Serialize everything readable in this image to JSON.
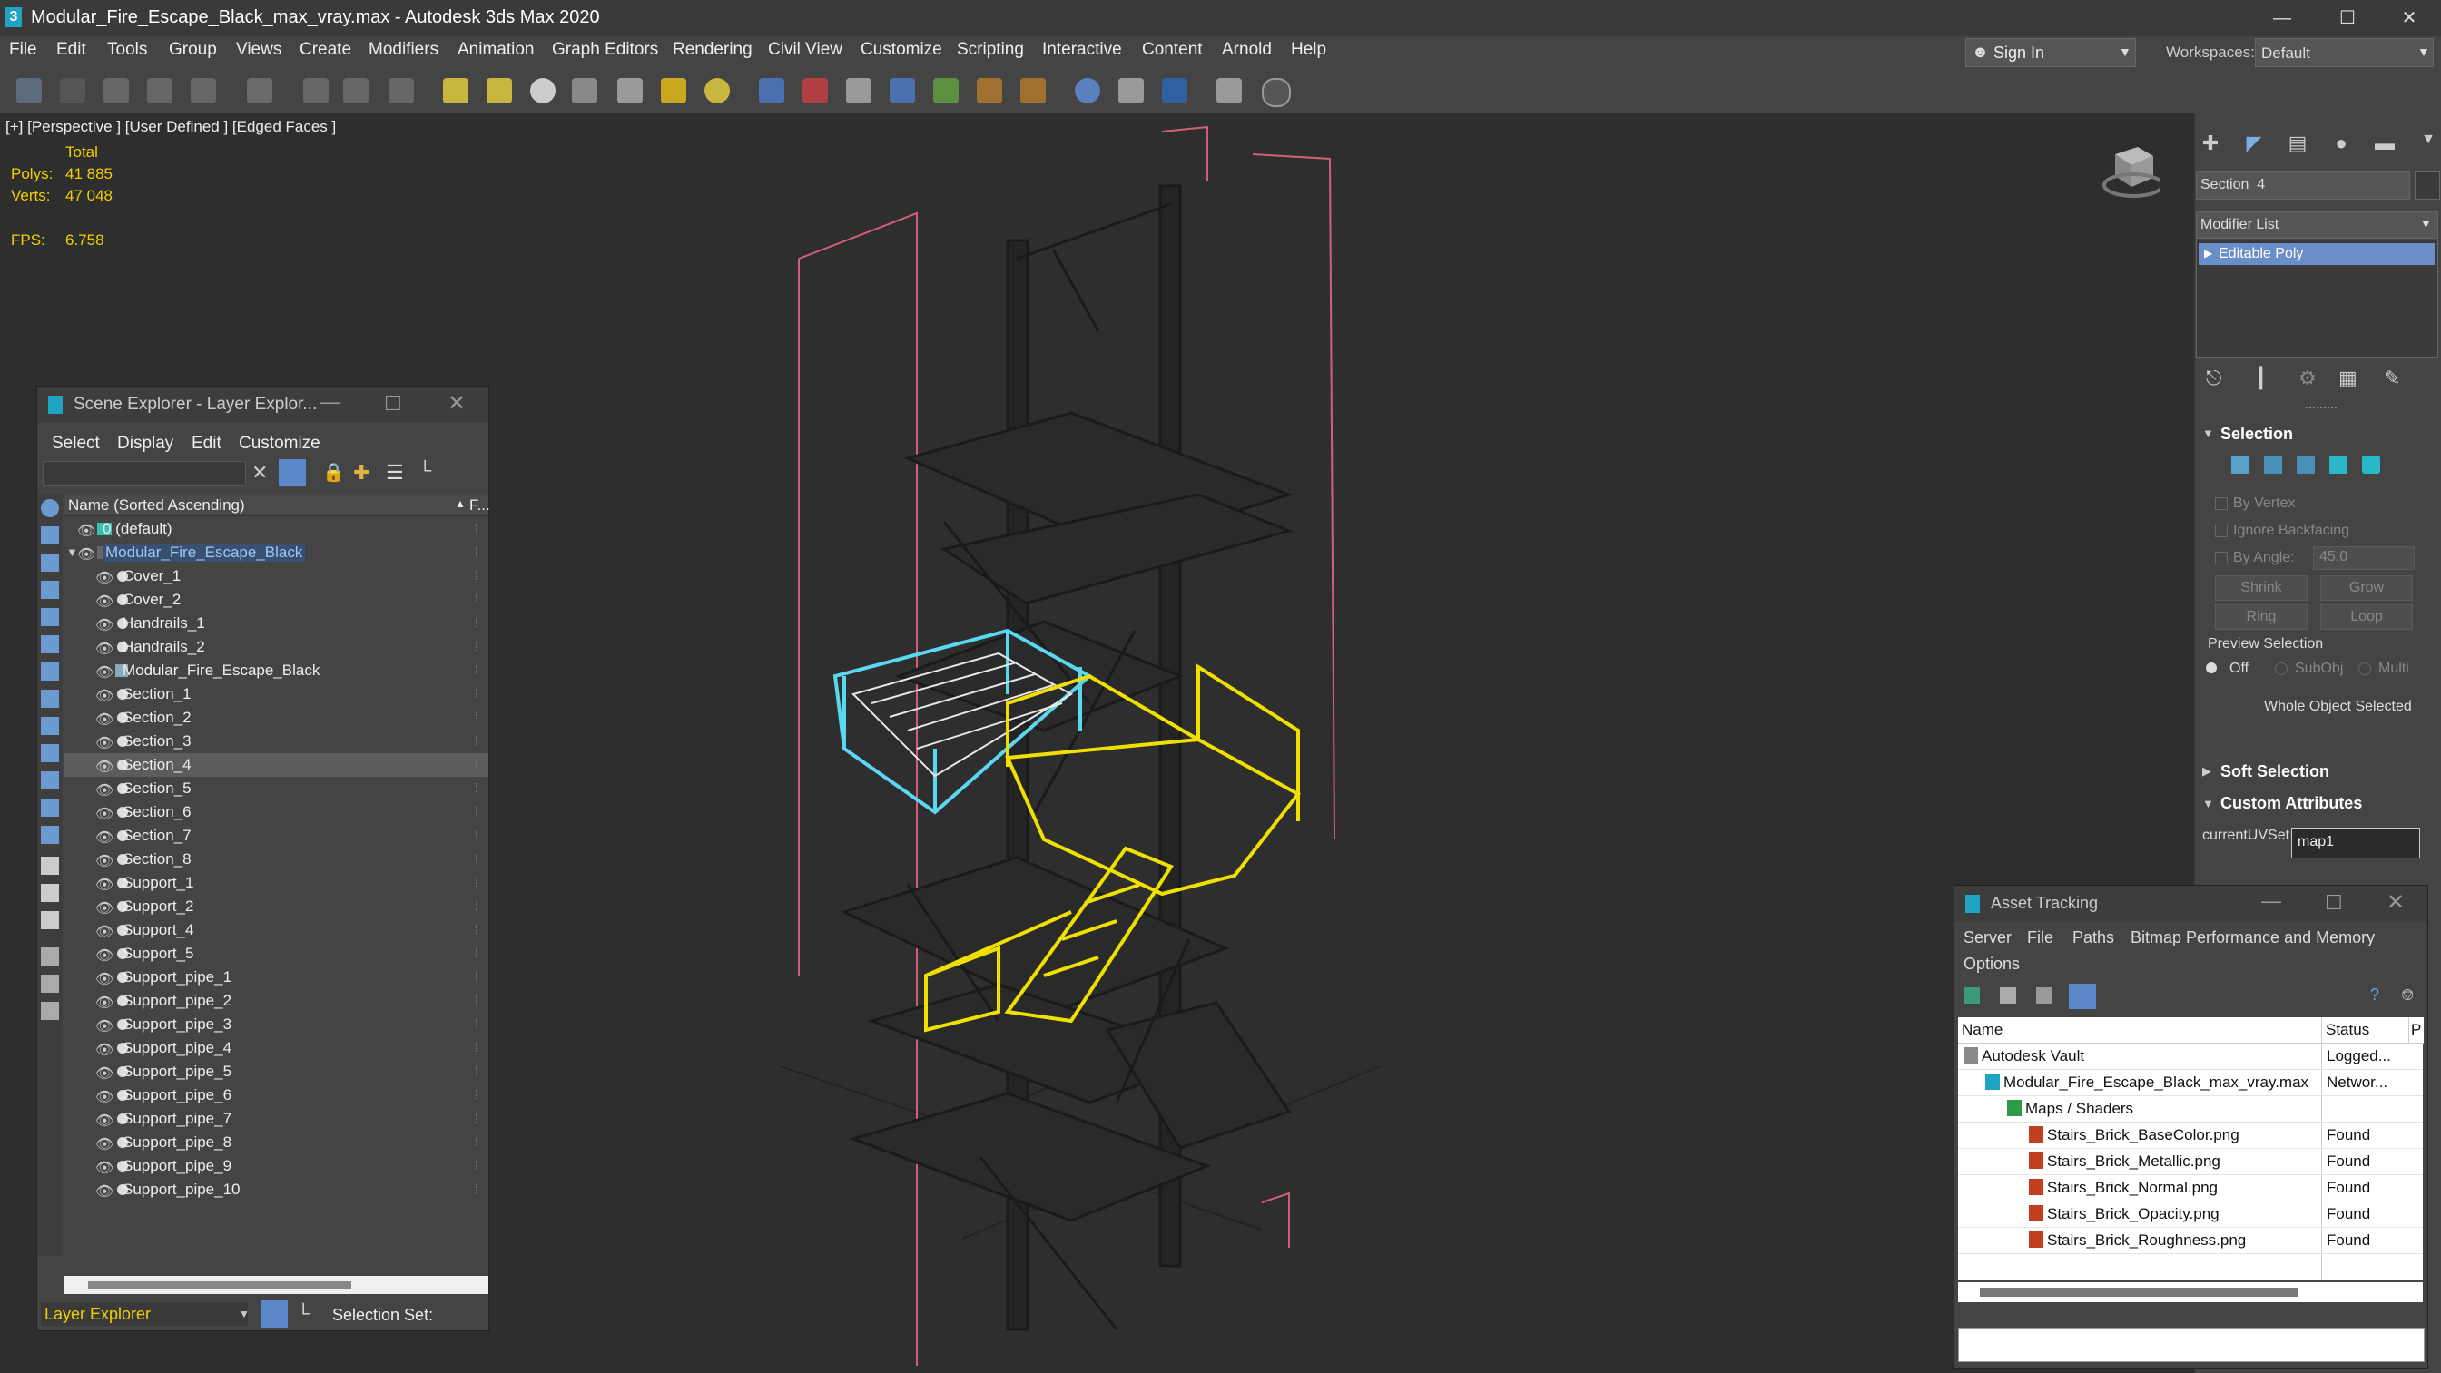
{
  "app": {
    "title": "Modular_Fire_Escape_Black_max_vray.max - Autodesk 3ds Max 2020",
    "window_controls": [
      "—",
      "☐",
      "✕"
    ]
  },
  "menubar": {
    "items": [
      "File",
      "Edit",
      "Tools",
      "Group",
      "Views",
      "Create",
      "Modifiers",
      "Animation",
      "Graph Editors",
      "Rendering",
      "Civil View",
      "Customize",
      "Scripting",
      "Interactive",
      "Content",
      "Arnold",
      "Help"
    ],
    "sign_in": "Sign In",
    "workspaces_label": "Workspaces:",
    "workspace": "Default"
  },
  "viewport": {
    "label": "[+] [Perspective ] [User Defined ] [Edged Faces ]",
    "stats": {
      "total_label": "Total",
      "polys_label": "Polys:",
      "polys": "41 885",
      "verts_label": "Verts:",
      "verts": "47 048",
      "fps_label": "FPS:",
      "fps": "6.758"
    }
  },
  "command_panel": {
    "object_name": "Section_4",
    "modifier_list": "Modifier List",
    "stack_item": "Editable Poly",
    "selection": {
      "header": "Selection",
      "by_vertex": "By Vertex",
      "ignore_backfacing": "Ignore Backfacing",
      "by_angle": "By Angle:",
      "angle_value": "45.0",
      "shrink": "Shrink",
      "grow": "Grow",
      "ring": "Ring",
      "loop": "Loop",
      "preview_selection": "Preview Selection",
      "off": "Off",
      "subobj": "SubObj",
      "multi": "Multi",
      "status": "Whole Object Selected"
    },
    "soft_selection": "Soft Selection",
    "custom_attributes": "Custom Attributes",
    "current_uv_label": "currentUVSet",
    "current_uv_value": "map1"
  },
  "scene_explorer": {
    "title": "Scene Explorer - Layer Explor...",
    "menu": [
      "Select",
      "Display",
      "Edit",
      "Customize"
    ],
    "column_header": "Name (Sorted Ascending)",
    "column_extra": "F...",
    "rows": [
      {
        "label": "0 (default)",
        "level": 0,
        "kind": "layer"
      },
      {
        "label": "Modular_Fire_Escape_Black",
        "level": 0,
        "kind": "layer-open"
      },
      {
        "label": "Cover_1",
        "level": 1,
        "kind": "obj"
      },
      {
        "label": "Cover_2",
        "level": 1,
        "kind": "obj"
      },
      {
        "label": "Handrails_1",
        "level": 1,
        "kind": "obj"
      },
      {
        "label": "Handrails_2",
        "level": 1,
        "kind": "obj"
      },
      {
        "label": "Modular_Fire_Escape_Black",
        "level": 1,
        "kind": "group"
      },
      {
        "label": "Section_1",
        "level": 1,
        "kind": "obj"
      },
      {
        "label": "Section_2",
        "level": 1,
        "kind": "obj"
      },
      {
        "label": "Section_3",
        "level": 1,
        "kind": "obj"
      },
      {
        "label": "Section_4",
        "level": 1,
        "kind": "obj-selected"
      },
      {
        "label": "Section_5",
        "level": 1,
        "kind": "obj"
      },
      {
        "label": "Section_6",
        "level": 1,
        "kind": "obj"
      },
      {
        "label": "Section_7",
        "level": 1,
        "kind": "obj"
      },
      {
        "label": "Section_8",
        "level": 1,
        "kind": "obj"
      },
      {
        "label": "Support_1",
        "level": 1,
        "kind": "obj"
      },
      {
        "label": "Support_2",
        "level": 1,
        "kind": "obj"
      },
      {
        "label": "Support_4",
        "level": 1,
        "kind": "obj"
      },
      {
        "label": "Support_5",
        "level": 1,
        "kind": "obj"
      },
      {
        "label": "Support_pipe_1",
        "level": 1,
        "kind": "obj"
      },
      {
        "label": "Support_pipe_2",
        "level": 1,
        "kind": "obj"
      },
      {
        "label": "Support_pipe_3",
        "level": 1,
        "kind": "obj"
      },
      {
        "label": "Support_pipe_4",
        "level": 1,
        "kind": "obj"
      },
      {
        "label": "Support_pipe_5",
        "level": 1,
        "kind": "obj"
      },
      {
        "label": "Support_pipe_6",
        "level": 1,
        "kind": "obj"
      },
      {
        "label": "Support_pipe_7",
        "level": 1,
        "kind": "obj"
      },
      {
        "label": "Support_pipe_8",
        "level": 1,
        "kind": "obj"
      },
      {
        "label": "Support_pipe_9",
        "level": 1,
        "kind": "obj"
      },
      {
        "label": "Support_pipe_10",
        "level": 1,
        "kind": "obj"
      }
    ],
    "layer_explorer": "Layer Explorer",
    "selection_set": "Selection Set:"
  },
  "asset_tracking": {
    "title": "Asset Tracking",
    "menu": [
      "Server",
      "File",
      "Paths",
      "Bitmap Performance and Memory"
    ],
    "menu2": "Options",
    "col_name": "Name",
    "col_status": "Status",
    "col_extra": "P",
    "rows": [
      {
        "name": "Autodesk Vault",
        "status": "Logged...",
        "indent": 0,
        "icon": "vault"
      },
      {
        "name": "Modular_Fire_Escape_Black_max_vray.max",
        "status": "Networ...",
        "indent": 1,
        "icon": "max"
      },
      {
        "name": "Maps / Shaders",
        "status": "",
        "indent": 2,
        "icon": "folder"
      },
      {
        "name": "Stairs_Brick_BaseColor.png",
        "status": "Found",
        "indent": 3,
        "icon": "png"
      },
      {
        "name": "Stairs_Brick_Metallic.png",
        "status": "Found",
        "indent": 3,
        "icon": "png"
      },
      {
        "name": "Stairs_Brick_Normal.png",
        "status": "Found",
        "indent": 3,
        "icon": "png"
      },
      {
        "name": "Stairs_Brick_Opacity.png",
        "status": "Found",
        "indent": 3,
        "icon": "png"
      },
      {
        "name": "Stairs_Brick_Roughness.png",
        "status": "Found",
        "indent": 3,
        "icon": "png"
      }
    ]
  },
  "colors": {
    "selected_yellow": "#f0e000",
    "selected_cyan": "#5ad8f0",
    "bbox_pink": "#d0607a",
    "stats_yellow": "#f0d000",
    "highlight_blue": "#6a8ec8"
  }
}
